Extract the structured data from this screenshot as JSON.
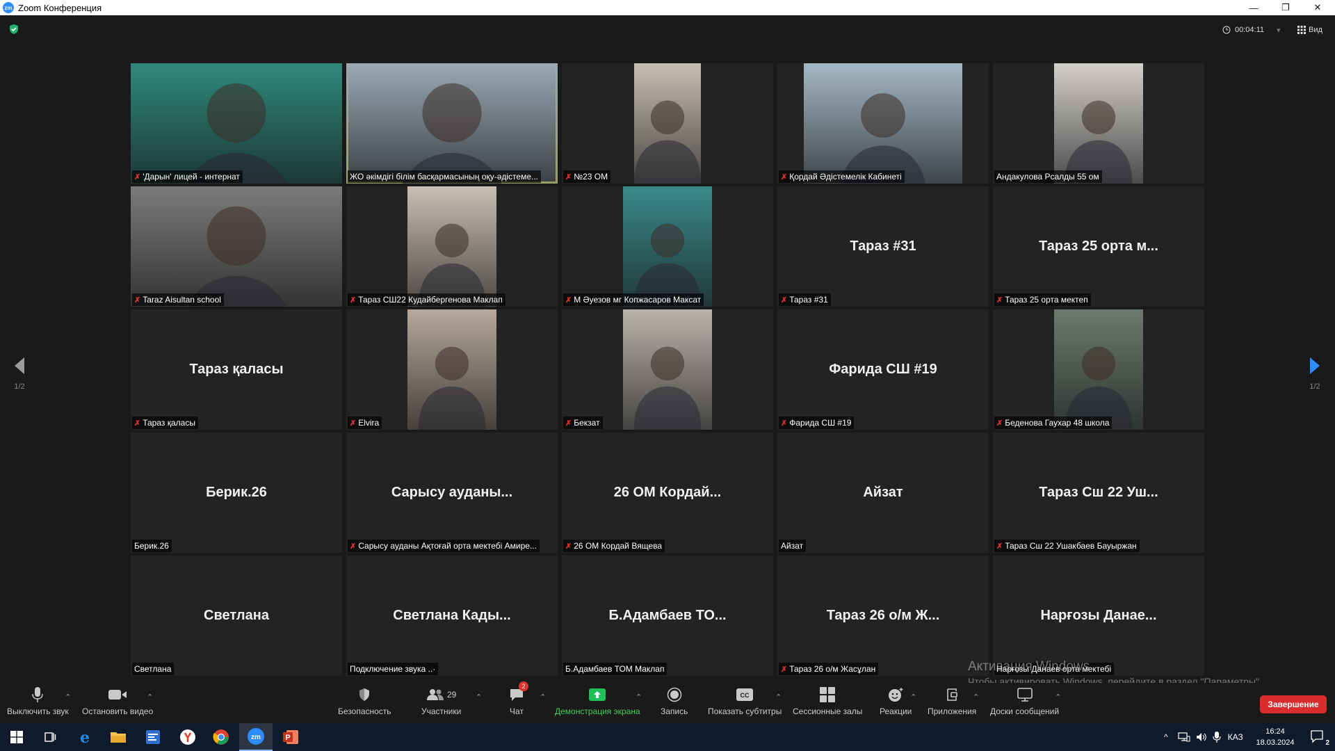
{
  "window": {
    "title": "Zoom Конференция"
  },
  "topbar": {
    "timer": "00:04:11",
    "view_label": "Вид"
  },
  "pager": {
    "left_label": "1/2",
    "right_label": "1/2"
  },
  "tiles": [
    {
      "big": "",
      "tag": "'Дарын' лицей - интернат",
      "muted": true,
      "video": "full",
      "bg": "#2f8a7d"
    },
    {
      "big": "",
      "tag": "ЖО әкімдігі білім басқармасының оқу-әдістеме...",
      "muted": false,
      "video": "full",
      "bg": "#9aa9b5",
      "speaking": true
    },
    {
      "big": "",
      "tag": "№23 ОМ",
      "muted": true,
      "video": "narrow",
      "bg": "#c7bfb3"
    },
    {
      "big": "",
      "tag": "Қордай Әдістемелік Кабинеті",
      "muted": true,
      "video": "wide",
      "bg": "#a5b9c6"
    },
    {
      "big": "",
      "tag": "Андакулова Рсалды 55 ом",
      "muted": false,
      "video": "mid",
      "bg": "#d3d0cc"
    },
    {
      "big": "",
      "tag": "Taraz Aisultan school",
      "muted": true,
      "video": "full",
      "bg": "#7b7c7a"
    },
    {
      "big": "",
      "tag": "Тараз СШ22 Кудайбергенова Маклап",
      "muted": true,
      "video": "mid",
      "bg": "#c9c0b4"
    },
    {
      "big": "",
      "tag": "М Әуезов мг Копжасаров Максат",
      "muted": true,
      "video": "mid",
      "bg": "#3a8a8a"
    },
    {
      "big": "Тараз #31",
      "tag": "Тараз #31",
      "muted": true
    },
    {
      "big": "Тараз 25 орта м...",
      "tag": "Тараз 25 орта мектеп",
      "muted": true
    },
    {
      "big": "Тараз қаласы",
      "tag": "Тараз қаласы",
      "muted": true
    },
    {
      "big": "",
      "tag": "Elvira",
      "muted": true,
      "video": "mid",
      "bg": "#b7a99b"
    },
    {
      "big": "",
      "tag": "Бекзат",
      "muted": true,
      "video": "mid",
      "bg": "#b9b4ad"
    },
    {
      "big": "Фарида СШ #19",
      "tag": "Фарида СШ #19",
      "muted": true
    },
    {
      "big": "",
      "tag": "Беденова Гаухар 48 школа",
      "muted": true,
      "video": "mid",
      "bg": "#6c7a70"
    },
    {
      "big": "Берик.26",
      "tag": "Берик.26",
      "muted": false
    },
    {
      "big": "Сарысу ауданы...",
      "tag": "Сарысу ауданы Ақтоғай орта мектебі Амире...",
      "muted": true
    },
    {
      "big": "26 ОМ Кордай...",
      "tag": "26 ОМ Кордай Вящева",
      "muted": true
    },
    {
      "big": "Айзат",
      "tag": "Айзат",
      "muted": false
    },
    {
      "big": "Тараз Сш 22 Уш...",
      "tag": "Тараз Сш 22 Ушакбаев Бауыржан",
      "muted": true
    },
    {
      "big": "Светлана",
      "tag": "Светлана",
      "muted": false
    },
    {
      "big": "Светлана Кады...",
      "tag": "Подключение звука ..·",
      "muted": false
    },
    {
      "big": "Б.Адамбаев ТО...",
      "tag": "Б.Адамбаев ТОМ Маклап",
      "muted": false
    },
    {
      "big": "Тараз 26 о/м Ж...",
      "tag": "Тараз 26 о/м Жасұлан",
      "muted": true
    },
    {
      "big": "Нарғозы Данае...",
      "tag": "Нарғозы Данаев орта мектебі",
      "muted": false
    }
  ],
  "watermark": {
    "line1": "Активация Windows",
    "line2": "Чтобы активировать Windows, перейдите в раздел \"Параметры\"."
  },
  "toolbar": {
    "mute": "Выключить звук",
    "video": "Остановить видео",
    "security": "Безопасность",
    "participants": "Участники",
    "participants_count": "29",
    "chat": "Чат",
    "chat_badge": "2",
    "share": "Демонстрация экрана",
    "record": "Запись",
    "captions": "Показать субтитры",
    "breakout": "Сессионные залы",
    "reactions": "Реакции",
    "apps": "Приложения",
    "whiteboards": "Доски сообщений",
    "end": "Завершение"
  },
  "taskbar": {
    "lang": "КАЗ",
    "time": "16:24",
    "date": "18.03.2024",
    "notif_count": "2"
  },
  "colors": {
    "speaker_outline": "#e7f06a",
    "share_green": "#3fcf5a",
    "end_red": "#d92c2c",
    "mute_red": "#e0322d"
  }
}
